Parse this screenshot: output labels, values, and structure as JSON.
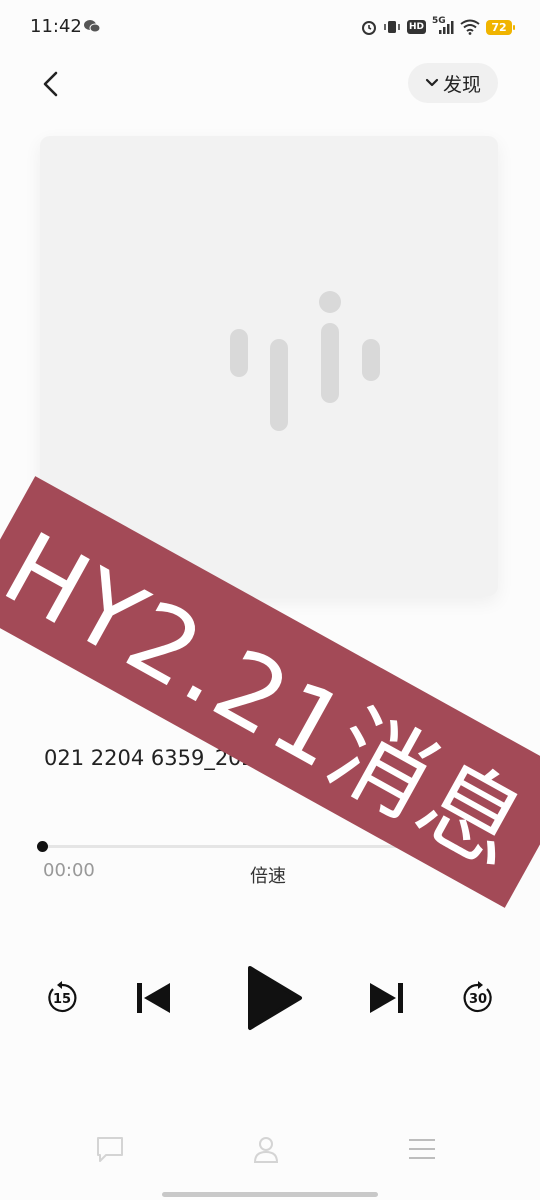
{
  "status_bar": {
    "time": "11:42",
    "network": "5G",
    "hd": "HD",
    "battery": "72",
    "icons": [
      "wechat-icon",
      "alarm-icon",
      "vibrate-icon",
      "hd-icon",
      "signal-icon",
      "wifi-icon",
      "battery-icon"
    ]
  },
  "header": {
    "back_icon": "chevron-left-icon",
    "discover_label": "发现",
    "discover_icon": "chevron-down-icon"
  },
  "cover": {
    "logo_icon": "voice-waveform-logo-icon"
  },
  "track": {
    "title": "021 2204 6359_2024"
  },
  "progress": {
    "current": "00:00",
    "total": "00:00",
    "speed_label": "倍速",
    "fraction": 0
  },
  "controls": {
    "rewind_seconds": "15",
    "forward_seconds": "30",
    "icons": [
      "rewind-15-icon",
      "previous-icon",
      "play-icon",
      "next-icon",
      "forward-30-icon"
    ]
  },
  "watermark": {
    "text": "HY2.21消息"
  },
  "bottom_bar": {
    "icons": [
      "chat-icon",
      "user-icon",
      "menu-icon"
    ]
  },
  "colors": {
    "watermark_bg": "#a34a57",
    "battery": "#f0b400",
    "background": "#fcfcfc"
  }
}
